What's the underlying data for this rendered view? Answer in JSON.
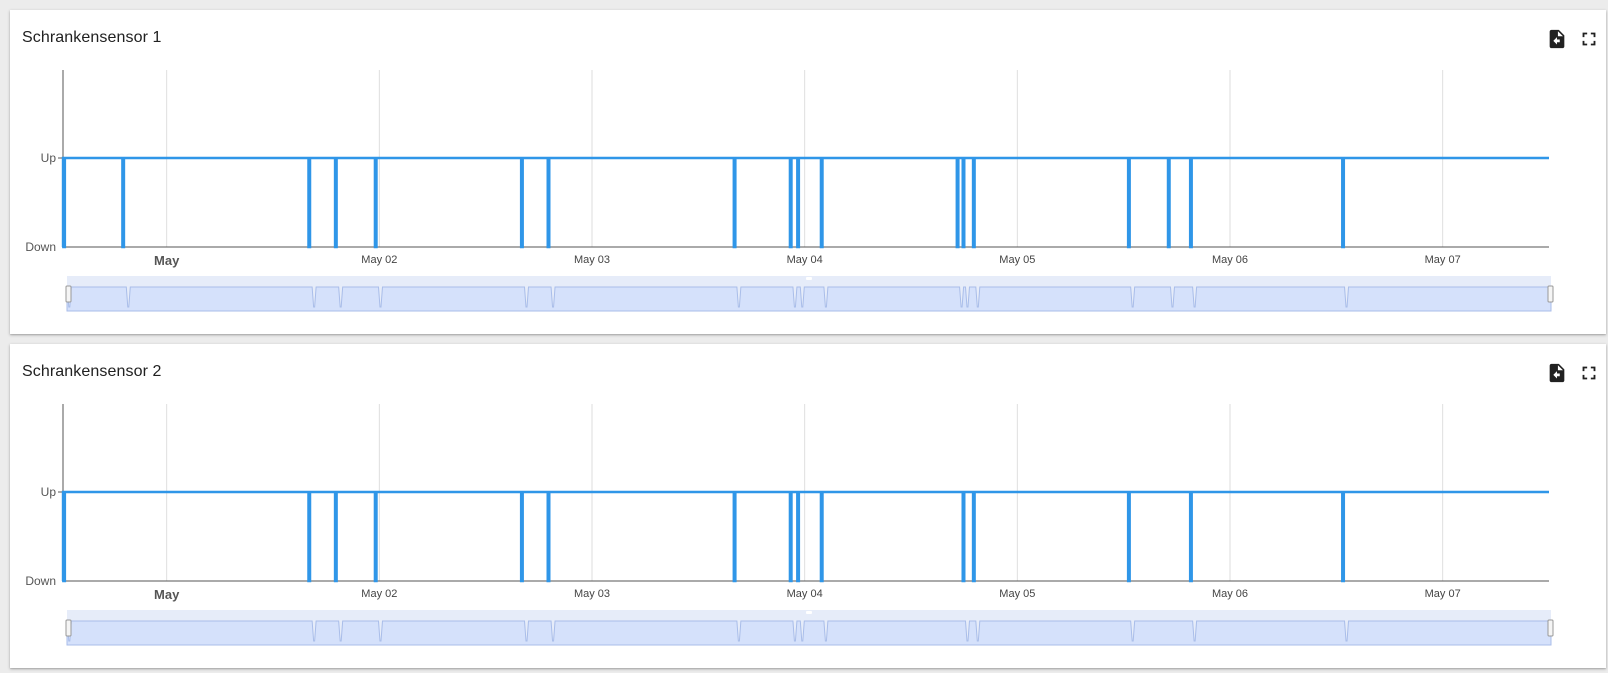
{
  "cards": [
    {
      "title": "Schrankensensor 1",
      "export_icon": "file-export-icon",
      "fullscreen_icon": "fullscreen-icon"
    },
    {
      "title": "Schrankensensor 2",
      "export_icon": "file-export-icon",
      "fullscreen_icon": "fullscreen-icon"
    }
  ],
  "colors": {
    "line": "#2f96e8",
    "navigator_fill": "#d5e1fb",
    "navigator_mask": "#e6ecf9",
    "grid": "#dedede",
    "axis": "#555555"
  },
  "chart_data": [
    {
      "type": "line",
      "step": true,
      "title": "Schrankensensor 1",
      "y_categories": [
        "Down",
        "Up"
      ],
      "ylim": [
        0,
        2
      ],
      "xlim": [
        "2024-04-30T12:18",
        "2024-05-07T12:00"
      ],
      "x_ticks": [
        "May",
        "May 02",
        "May 03",
        "May 04",
        "May 05",
        "May 06",
        "May 07"
      ],
      "x_tick_dates": [
        "2024-05-01",
        "2024-05-02",
        "2024-05-03",
        "2024-05-04",
        "2024-05-05",
        "2024-05-06",
        "2024-05-07"
      ],
      "drops": [
        "2024-04-30T12:20",
        "2024-04-30T19:00",
        "2024-05-01T16:00",
        "2024-05-01T19:00",
        "2024-05-01T23:30",
        "2024-05-02T16:00",
        "2024-05-02T19:00",
        "2024-05-03T16:00",
        "2024-05-03T22:20",
        "2024-05-03T23:10",
        "2024-05-04T01:50",
        "2024-05-04T17:10",
        "2024-05-04T17:50",
        "2024-05-04T19:00",
        "2024-05-05T12:30",
        "2024-05-05T17:00",
        "2024-05-05T19:30",
        "2024-05-06T12:40"
      ],
      "grid": true,
      "navigator": true
    },
    {
      "type": "line",
      "step": true,
      "title": "Schrankensensor 2",
      "y_categories": [
        "Down",
        "Up"
      ],
      "ylim": [
        0,
        2
      ],
      "xlim": [
        "2024-04-30T12:18",
        "2024-05-07T12:00"
      ],
      "x_ticks": [
        "May",
        "May 02",
        "May 03",
        "May 04",
        "May 05",
        "May 06",
        "May 07"
      ],
      "x_tick_dates": [
        "2024-05-01",
        "2024-05-02",
        "2024-05-03",
        "2024-05-04",
        "2024-05-05",
        "2024-05-06",
        "2024-05-07"
      ],
      "drops": [
        "2024-04-30T12:20",
        "2024-05-01T16:00",
        "2024-05-01T19:00",
        "2024-05-01T23:30",
        "2024-05-02T16:00",
        "2024-05-02T19:00",
        "2024-05-03T16:00",
        "2024-05-03T22:20",
        "2024-05-03T23:10",
        "2024-05-04T01:50",
        "2024-05-04T17:50",
        "2024-05-04T19:00",
        "2024-05-05T12:30",
        "2024-05-05T19:30",
        "2024-05-06T12:40"
      ],
      "grid": true,
      "navigator": true
    }
  ]
}
